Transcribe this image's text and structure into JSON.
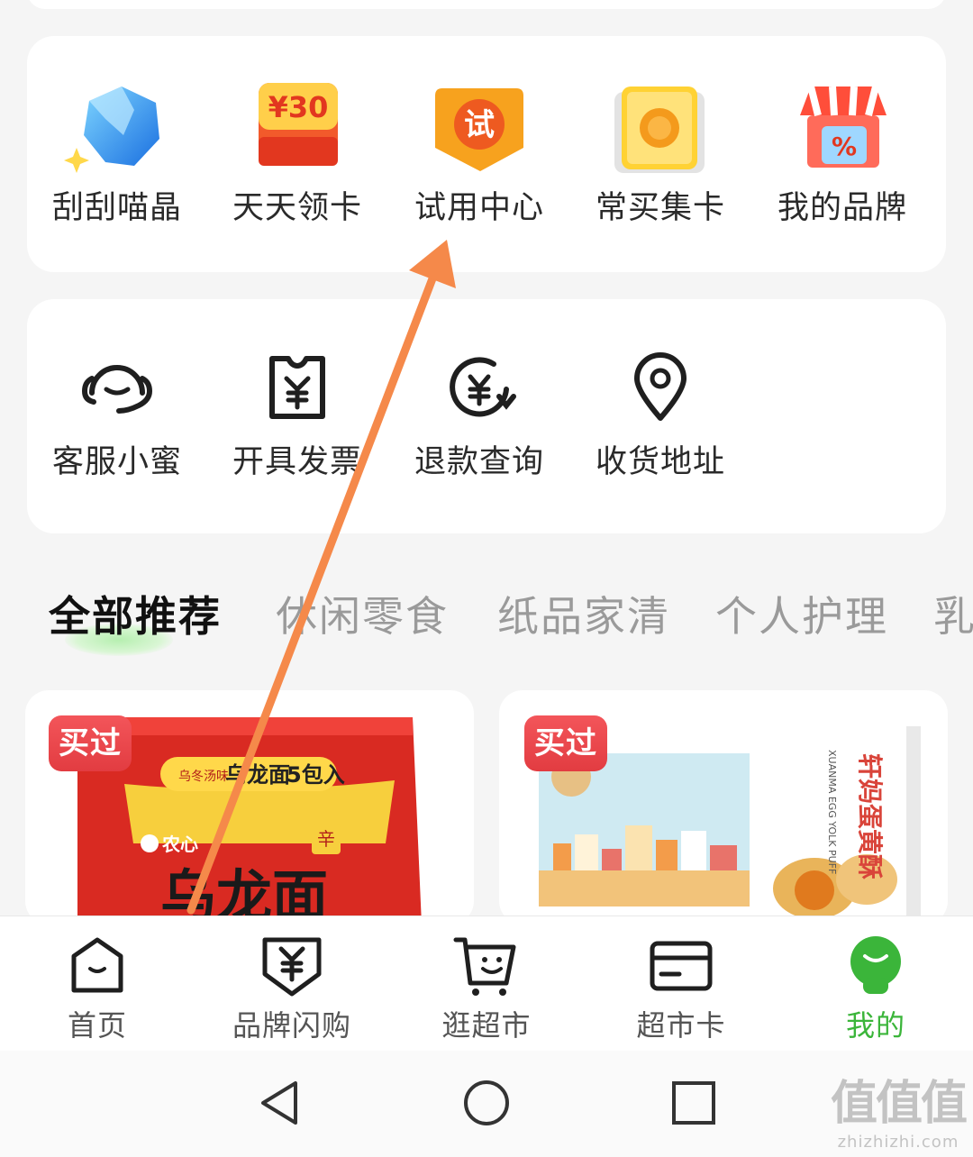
{
  "activities": [
    {
      "label": "刮刮喵晶",
      "icon": "blue-crystal-icon"
    },
    {
      "label": "天天领卡",
      "icon": "coupon-card-icon",
      "badge": "¥30"
    },
    {
      "label": "试用中心",
      "icon": "trial-badge-icon",
      "badge": "试"
    },
    {
      "label": "常买集卡",
      "icon": "cookie-card-icon"
    },
    {
      "label": "我的品牌",
      "icon": "brand-store-icon",
      "badge": "%"
    }
  ],
  "services": [
    {
      "label": "客服小蜜",
      "icon": "customer-service-icon"
    },
    {
      "label": "开具发票",
      "icon": "invoice-icon"
    },
    {
      "label": "退款查询",
      "icon": "refund-icon"
    },
    {
      "label": "收货地址",
      "icon": "location-pin-icon"
    }
  ],
  "category_tabs": [
    "全部推荐",
    "休闲零食",
    "纸品家清",
    "个人护理",
    "乳"
  ],
  "active_tab": "全部推荐",
  "products": [
    {
      "badge": "买过",
      "image_texts": [
        "乌冬汤味",
        "乌龙面",
        "5包入",
        "农心",
        "辛",
        "乌龙面"
      ]
    },
    {
      "badge": "买过",
      "image_texts": [
        "轩妈蛋黄酥",
        "XUANMA EGG YOLK PUFF"
      ]
    }
  ],
  "bottom_nav": [
    {
      "label": "首页",
      "icon": "home-icon"
    },
    {
      "label": "品牌闪购",
      "icon": "brand-flash-icon"
    },
    {
      "label": "逛超市",
      "icon": "shopping-cart-icon"
    },
    {
      "label": "超市卡",
      "icon": "card-icon"
    },
    {
      "label": "我的",
      "icon": "profile-icon",
      "active": true
    }
  ],
  "colors": {
    "accent_green": "#3bb53a",
    "annotation_arrow": "#f5894a",
    "badge_red": "#e23c41"
  },
  "watermark": {
    "main": "值值值",
    "sub": "zhizhizhi.com"
  }
}
